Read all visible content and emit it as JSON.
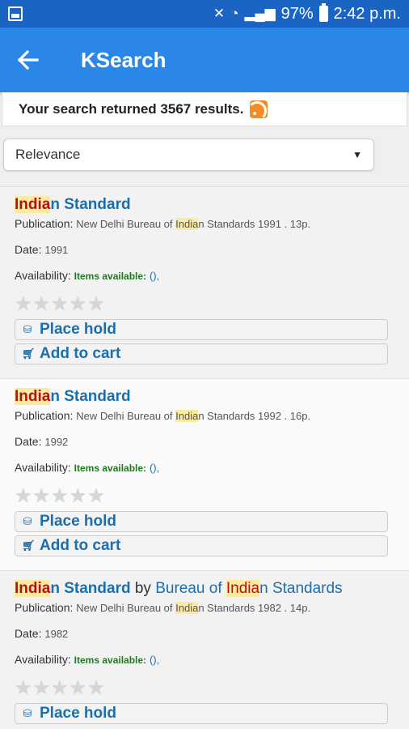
{
  "status_bar": {
    "battery": "97%",
    "time": "2:42 p.m."
  },
  "app_bar": {
    "title": "KSearch"
  },
  "results": {
    "text": "Your search returned 3567 results."
  },
  "sort": {
    "selected": "Relevance"
  },
  "labels": {
    "publication": "Publication:",
    "date": "Date:",
    "availability": "Availability:",
    "items_available": "Items available:",
    "avail_paren": "(),",
    "place_hold": "Place hold",
    "add_to_cart": "Add to cart",
    "by": "by"
  },
  "items": [
    {
      "title_hl": "India",
      "title_rest": "n Standard",
      "pub_before": "New Delhi Bureau of ",
      "pub_hl": "India",
      "pub_after": "n Standards 1991 . 13p.",
      "date": "1991"
    },
    {
      "title_hl": "India",
      "title_rest": "n Standard",
      "pub_before": "New Delhi Bureau of ",
      "pub_hl": "India",
      "pub_after": "n Standards 1992 . 16p.",
      "date": "1992"
    },
    {
      "title_hl": "India",
      "title_rest": "n Standard",
      "author_before": "Bureau of ",
      "author_hl": "India",
      "author_after": "n Standards",
      "pub_before": "New Delhi Bureau of ",
      "pub_hl": "India",
      "pub_after": "n Standards 1982 . 14p.",
      "date": "1982"
    }
  ],
  "colors": {
    "status_bar": "#1a64c4",
    "app_bar": "#2a87e8",
    "link": "#1b6fad",
    "highlight": "#fbeb9e",
    "available": "#1a7c1a"
  }
}
